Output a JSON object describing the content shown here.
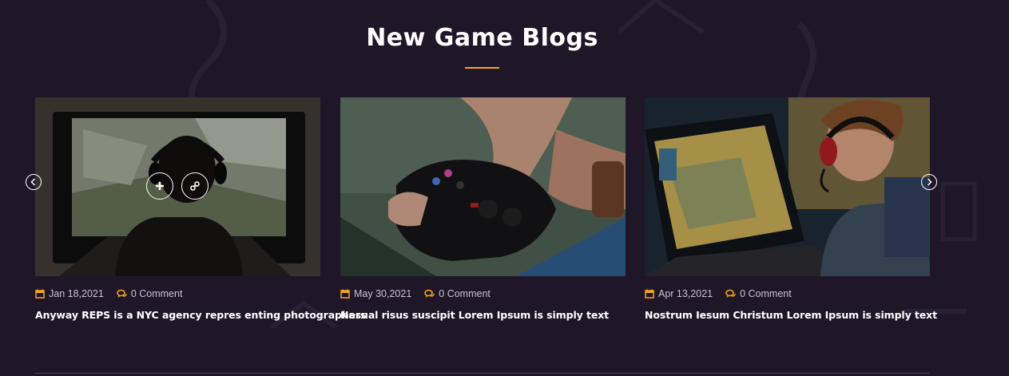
{
  "section": {
    "title": "New Game Blogs"
  },
  "colors": {
    "background": "#1f1628",
    "accent": "#f3a623",
    "text": "#ffffff",
    "meta_text": "#c9c3cf"
  },
  "carousel": {
    "prev_icon": "chevron-left-icon",
    "next_icon": "chevron-right-icon"
  },
  "overlay": {
    "plus_icon": "plus-icon",
    "link_icon": "link-icon"
  },
  "posts": [
    {
      "image": "boy-with-headphones-playing-on-tv",
      "date": "Jan 18,2021",
      "comments": "0 Comment",
      "title": "Anyway REPS is a NYC agency repres enting photographers"
    },
    {
      "image": "hands-holding-game-controller",
      "date": "May 30,2021",
      "comments": "0 Comment",
      "title": "Nasual risus suscipit Lorem Ipsum is simply text"
    },
    {
      "image": "gamer-with-red-headset-at-monitor",
      "date": "Apr 13,2021",
      "comments": "0 Comment",
      "title": "Nostrum Iesum Christum Lorem Ipsum is simply text"
    }
  ]
}
